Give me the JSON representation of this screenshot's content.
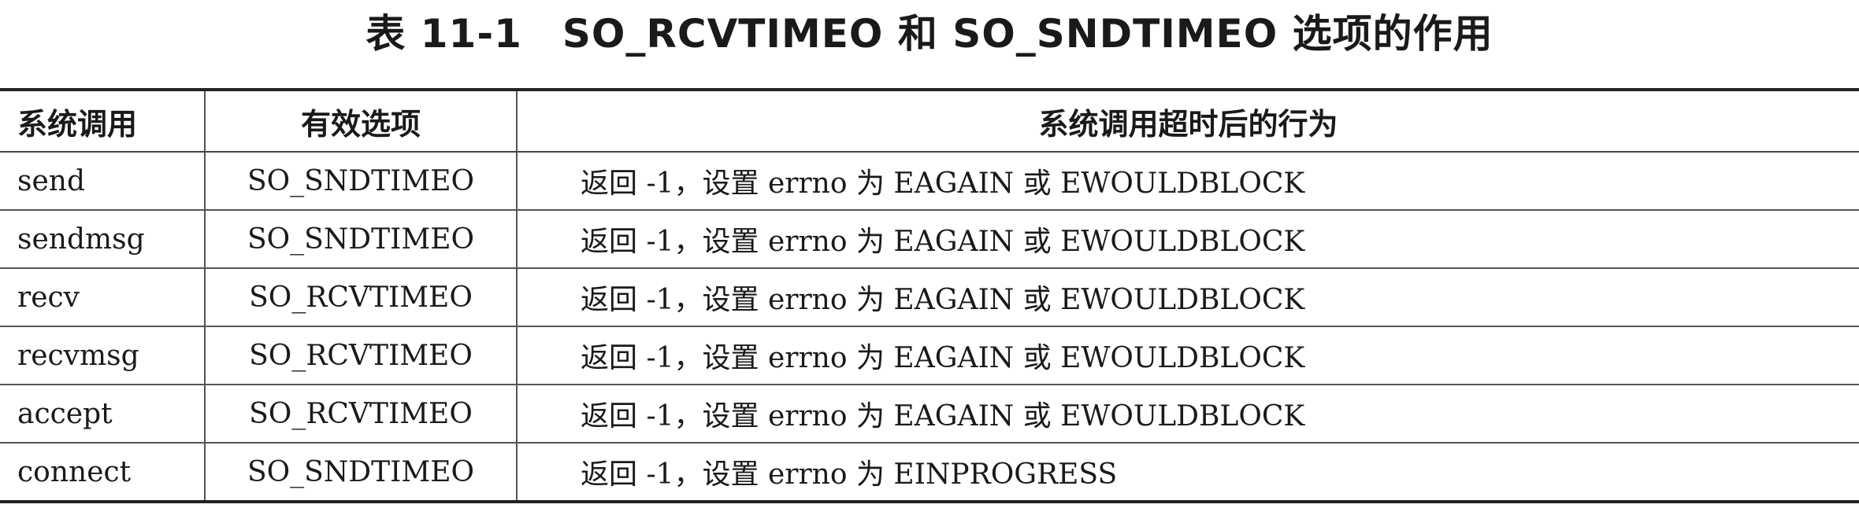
{
  "caption": "表 11-1　SO_RCVTIMEO 和 SO_SNDTIMEO 选项的作用",
  "table": {
    "headers": [
      "系统调用",
      "有效选项",
      "系统调用超时后的行为"
    ],
    "rows": [
      [
        "send",
        "SO_SNDTIMEO",
        "返回 -1，设置 errno 为 EAGAIN 或 EWOULDBLOCK"
      ],
      [
        "sendmsg",
        "SO_SNDTIMEO",
        "返回 -1，设置 errno 为 EAGAIN 或 EWOULDBLOCK"
      ],
      [
        "recv",
        "SO_RCVTIMEO",
        "返回 -1，设置 errno 为 EAGAIN 或 EWOULDBLOCK"
      ],
      [
        "recvmsg",
        "SO_RCVTIMEO",
        "返回 -1，设置 errno 为 EAGAIN 或 EWOULDBLOCK"
      ],
      [
        "accept",
        "SO_RCVTIMEO",
        "返回 -1，设置 errno 为 EAGAIN 或 EWOULDBLOCK"
      ],
      [
        "connect",
        "SO_SNDTIMEO",
        "返回 -1，设置 errno 为 EINPROGRESS"
      ]
    ]
  }
}
